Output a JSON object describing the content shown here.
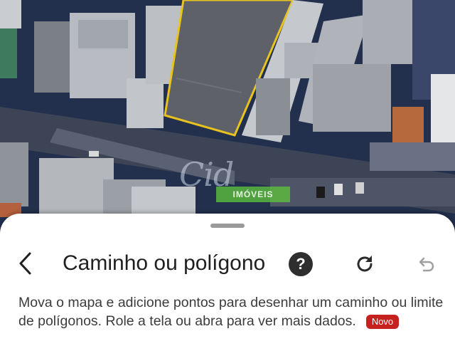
{
  "map": {
    "watermark_text": "Cid",
    "watermark_badge": "IMÓVEIS",
    "highlight_color": "#e8c31f"
  },
  "sheet": {
    "title": "Caminho ou polígono",
    "description": "Mova o mapa e adicione pontos para desenhar um caminho ou limite de polígonos. Role a tela ou abra para ver mais dados.",
    "badge": "Novo",
    "icons": {
      "back": "back-arrow-icon",
      "help": "help-circle-icon",
      "refresh": "refresh-icon",
      "undo": "undo-icon"
    },
    "help_label": "?"
  }
}
